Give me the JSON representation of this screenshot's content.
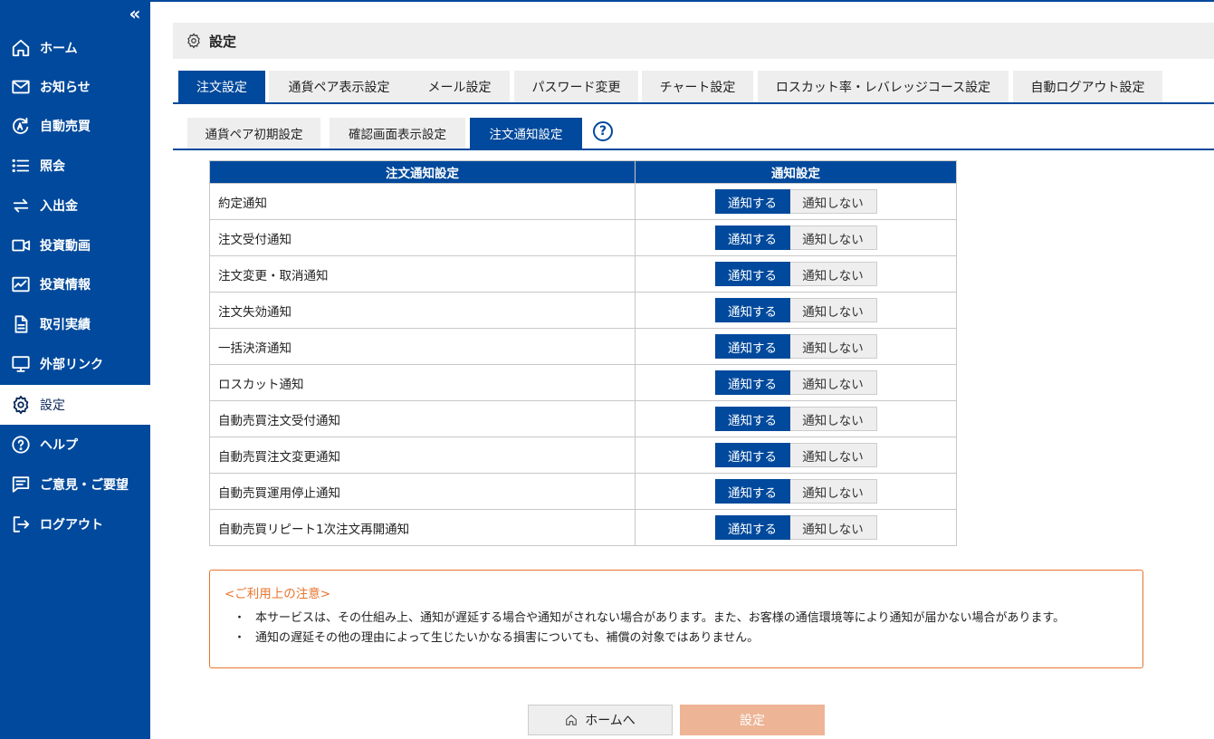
{
  "sidebar": {
    "collapse_icon": "double-chevron-left-icon",
    "items": [
      {
        "label": "ホーム",
        "icon": "home-icon"
      },
      {
        "label": "お知らせ",
        "icon": "mail-icon"
      },
      {
        "label": "自動売買",
        "icon": "auto-trade-icon"
      },
      {
        "label": "照会",
        "icon": "list-icon"
      },
      {
        "label": "入出金",
        "icon": "transfer-icon"
      },
      {
        "label": "投資動画",
        "icon": "video-icon"
      },
      {
        "label": "投資情報",
        "icon": "chart-board-icon"
      },
      {
        "label": "取引実績",
        "icon": "document-icon"
      },
      {
        "label": "外部リンク",
        "icon": "monitor-icon"
      },
      {
        "label": "設定",
        "icon": "gear-icon"
      },
      {
        "label": "ヘルプ",
        "icon": "help-icon"
      },
      {
        "label": "ご意見・ご要望",
        "icon": "feedback-icon"
      },
      {
        "label": "ログアウト",
        "icon": "logout-icon"
      }
    ],
    "active": "設定"
  },
  "header": {
    "title": "設定",
    "icon": "gear-icon"
  },
  "tabs_main": [
    {
      "label": "注文設定",
      "active": true
    },
    {
      "label": "通貨ペア表示設定",
      "active": false
    },
    {
      "label": "メール設定",
      "active": false
    },
    {
      "label": "パスワード変更",
      "active": false
    },
    {
      "label": "チャート設定",
      "active": false
    },
    {
      "label": "ロスカット率・レバレッジコース設定",
      "active": false
    },
    {
      "label": "自動ログアウト設定",
      "active": false
    }
  ],
  "tabs_sub": [
    {
      "label": "通貨ペア初期設定",
      "active": false
    },
    {
      "label": "確認画面表示設定",
      "active": false
    },
    {
      "label": "注文通知設定",
      "active": true
    }
  ],
  "help_mark": "?",
  "table": {
    "headers": [
      "注文通知設定",
      "通知設定"
    ],
    "toggle_on_label": "通知する",
    "toggle_off_label": "通知しない",
    "rows": [
      {
        "name": "約定通知",
        "value": "通知する"
      },
      {
        "name": "注文受付通知",
        "value": "通知する"
      },
      {
        "name": "注文変更・取消通知",
        "value": "通知する"
      },
      {
        "name": "注文失効通知",
        "value": "通知する"
      },
      {
        "name": "一括決済通知",
        "value": "通知する"
      },
      {
        "name": "ロスカット通知",
        "value": "通知する"
      },
      {
        "name": "自動売買注文受付通知",
        "value": "通知する"
      },
      {
        "name": "自動売買注文変更通知",
        "value": "通知する"
      },
      {
        "name": "自動売買運用停止通知",
        "value": "通知する"
      },
      {
        "name": "自動売買リピート1次注文再開通知",
        "value": "通知する"
      }
    ]
  },
  "notice": {
    "title": "<ご利用上の注意>",
    "bullet": "・",
    "lines": [
      "本サービスは、その仕組み上、通知が遅延する場合や通知がされない場合があります。また、お客様の通信環境等により通知が届かない場合があります。",
      "通知の遅延その他の理由によって生じたいかなる損害についても、補償の対象ではありません。"
    ]
  },
  "buttons": {
    "home": "ホームへ",
    "home_icon": "home-icon",
    "submit": "設定"
  },
  "colors": {
    "brand": "#00499c",
    "notice": "#e8742e",
    "submit_disabled": "#eeb496"
  }
}
